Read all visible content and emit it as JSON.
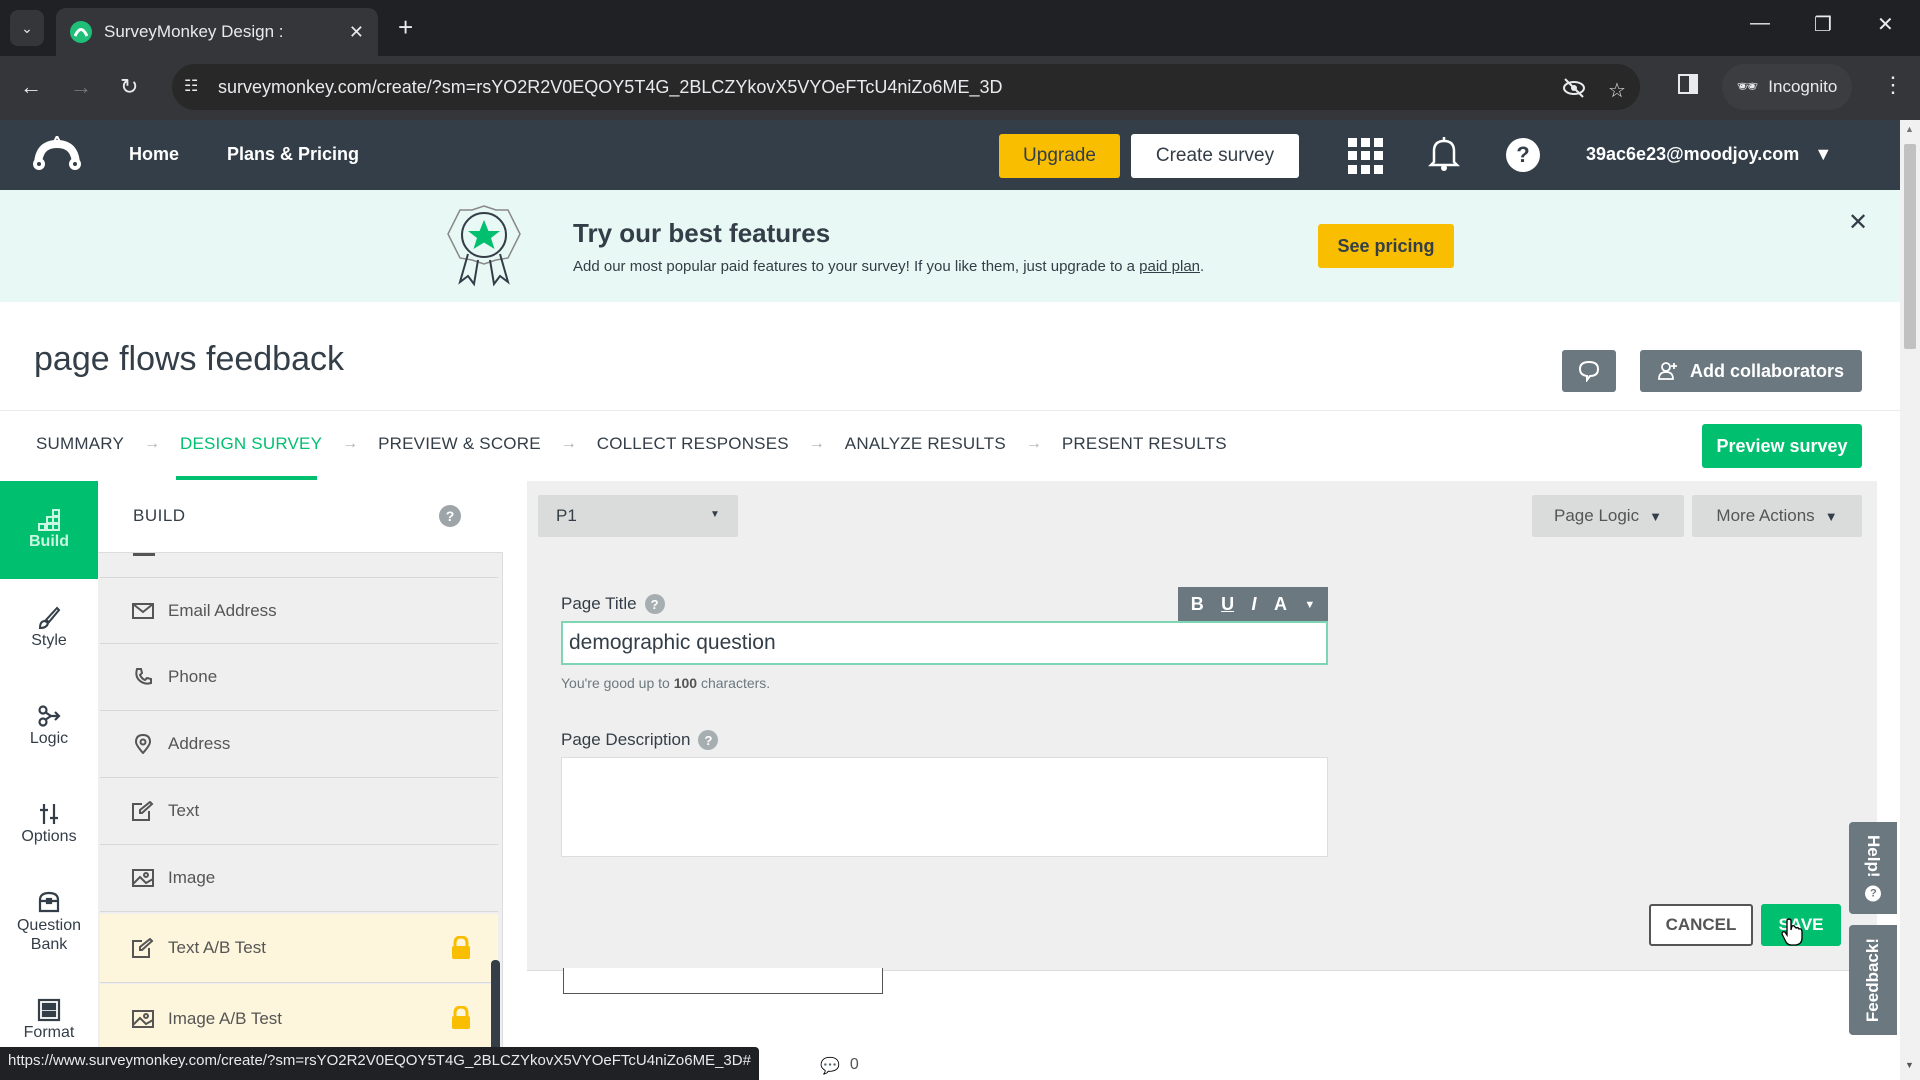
{
  "browser": {
    "tab_title": "SurveyMonkey Design :",
    "url": "surveymonkey.com/create/?sm=rsYO2R2V0EQOY5T4G_2BLCZYkovX5VYOeFTcU4niZo6ME_3D",
    "incognito_label": "Incognito",
    "status_url": "https://www.surveymonkey.com/create/?sm=rsYO2R2V0EQOY5T4G_2BLCZYkovX5VYOeFTcU4niZo6ME_3D#"
  },
  "header": {
    "nav": [
      {
        "label": "Home"
      },
      {
        "label": "Plans & Pricing"
      }
    ],
    "upgrade_label": "Upgrade",
    "create_label": "Create survey",
    "account_email": "39ac6e23@moodjoy.com"
  },
  "banner": {
    "title": "Try our best features",
    "text": "Add our most popular paid features to your survey! If you like them, just upgrade to a ",
    "link": "paid plan",
    "text_end": ".",
    "cta": "See pricing"
  },
  "survey": {
    "title": "page flows feedback",
    "add_collaborators": "Add collaborators",
    "preview_label": "Preview survey",
    "steps": [
      {
        "label": "SUMMARY",
        "active": false
      },
      {
        "label": "DESIGN SURVEY",
        "active": true
      },
      {
        "label": "PREVIEW & SCORE",
        "active": false
      },
      {
        "label": "COLLECT RESPONSES",
        "active": false
      },
      {
        "label": "ANALYZE RESULTS",
        "active": false
      },
      {
        "label": "PRESENT RESULTS",
        "active": false
      }
    ]
  },
  "left_nav": [
    {
      "label": "Build",
      "icon": "build-icon",
      "active": true
    },
    {
      "label": "Style",
      "icon": "brush-icon"
    },
    {
      "label": "Logic",
      "icon": "logic-icon"
    },
    {
      "label": "Options",
      "icon": "sliders-icon"
    },
    {
      "label": "Question Bank",
      "icon": "question-bank-icon"
    },
    {
      "label": "Format",
      "icon": "format-icon"
    }
  ],
  "build_panel": {
    "heading": "BUILD",
    "items": [
      {
        "label": "Email Address",
        "icon": "envelope-icon",
        "locked": false
      },
      {
        "label": "Phone",
        "icon": "phone-icon",
        "locked": false
      },
      {
        "label": "Address",
        "icon": "map-pin-icon",
        "locked": false
      },
      {
        "label": "Text",
        "icon": "edit-text-icon",
        "locked": false
      },
      {
        "label": "Image",
        "icon": "image-icon",
        "locked": false
      },
      {
        "label": "Text A/B Test",
        "icon": "edit-text-icon",
        "locked": true
      },
      {
        "label": "Image A/B Test",
        "icon": "image-icon",
        "locked": true
      }
    ]
  },
  "editor": {
    "page_select": "P1",
    "page_logic": "Page Logic",
    "more_actions": "More Actions",
    "page_title_label": "Page Title",
    "page_title_value": "demographic question",
    "format_buttons": [
      "B",
      "U",
      "I",
      "A"
    ],
    "hint_prefix": "You're good up to ",
    "hint_count": "100",
    "hint_suffix": " characters.",
    "page_description_label": "Page Description",
    "page_description_value": "",
    "cancel": "CANCEL",
    "save": "SAVE",
    "comment_count": "0"
  },
  "side_tabs": {
    "help": "Help!",
    "feedback": "Feedback!"
  },
  "colors": {
    "brand_green": "#00bf6f",
    "upgrade_yellow": "#f9be00",
    "nav_dark": "#333e48",
    "banner_bg": "#e8f8f4"
  }
}
